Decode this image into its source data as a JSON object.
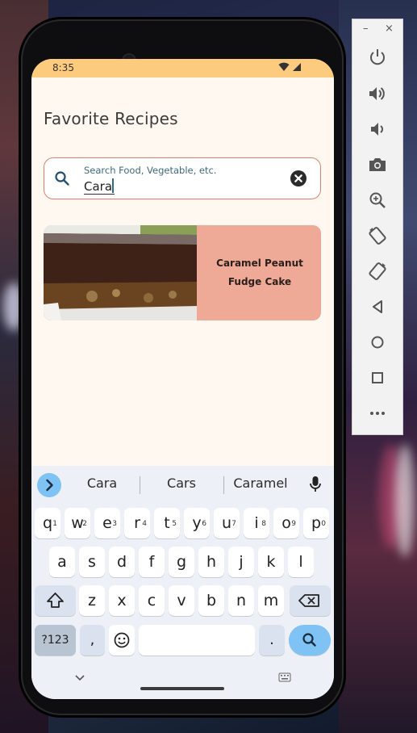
{
  "status_bar": {
    "time": "8:35"
  },
  "page": {
    "title": "Favorite Recipes"
  },
  "search": {
    "placeholder": "Search Food, Vegetable, etc.",
    "value": "Cara"
  },
  "recipes": [
    {
      "name_line1": "Caramel Peanut",
      "name_line2": "Fudge Cake"
    }
  ],
  "keyboard": {
    "suggestions": [
      "Cara",
      "Cars",
      "Caramel"
    ],
    "row1": [
      {
        "k": "q",
        "s": "1"
      },
      {
        "k": "w",
        "s": "2"
      },
      {
        "k": "e",
        "s": "3"
      },
      {
        "k": "r",
        "s": "4"
      },
      {
        "k": "t",
        "s": "5"
      },
      {
        "k": "y",
        "s": "6"
      },
      {
        "k": "u",
        "s": "7"
      },
      {
        "k": "i",
        "s": "8"
      },
      {
        "k": "o",
        "s": "9"
      },
      {
        "k": "p",
        "s": "0"
      }
    ],
    "row2": [
      "a",
      "s",
      "d",
      "f",
      "g",
      "h",
      "j",
      "k",
      "l"
    ],
    "row3": [
      "z",
      "x",
      "c",
      "v",
      "b",
      "n",
      "m"
    ],
    "sym_label": "?123",
    "comma": ",",
    "period": "."
  },
  "colors": {
    "status_bar": "#fdcb7e",
    "background": "#fff8f0",
    "search_border": "#d9826b",
    "card": "#eeaa97",
    "accent_blue": "#7ec3f4"
  }
}
